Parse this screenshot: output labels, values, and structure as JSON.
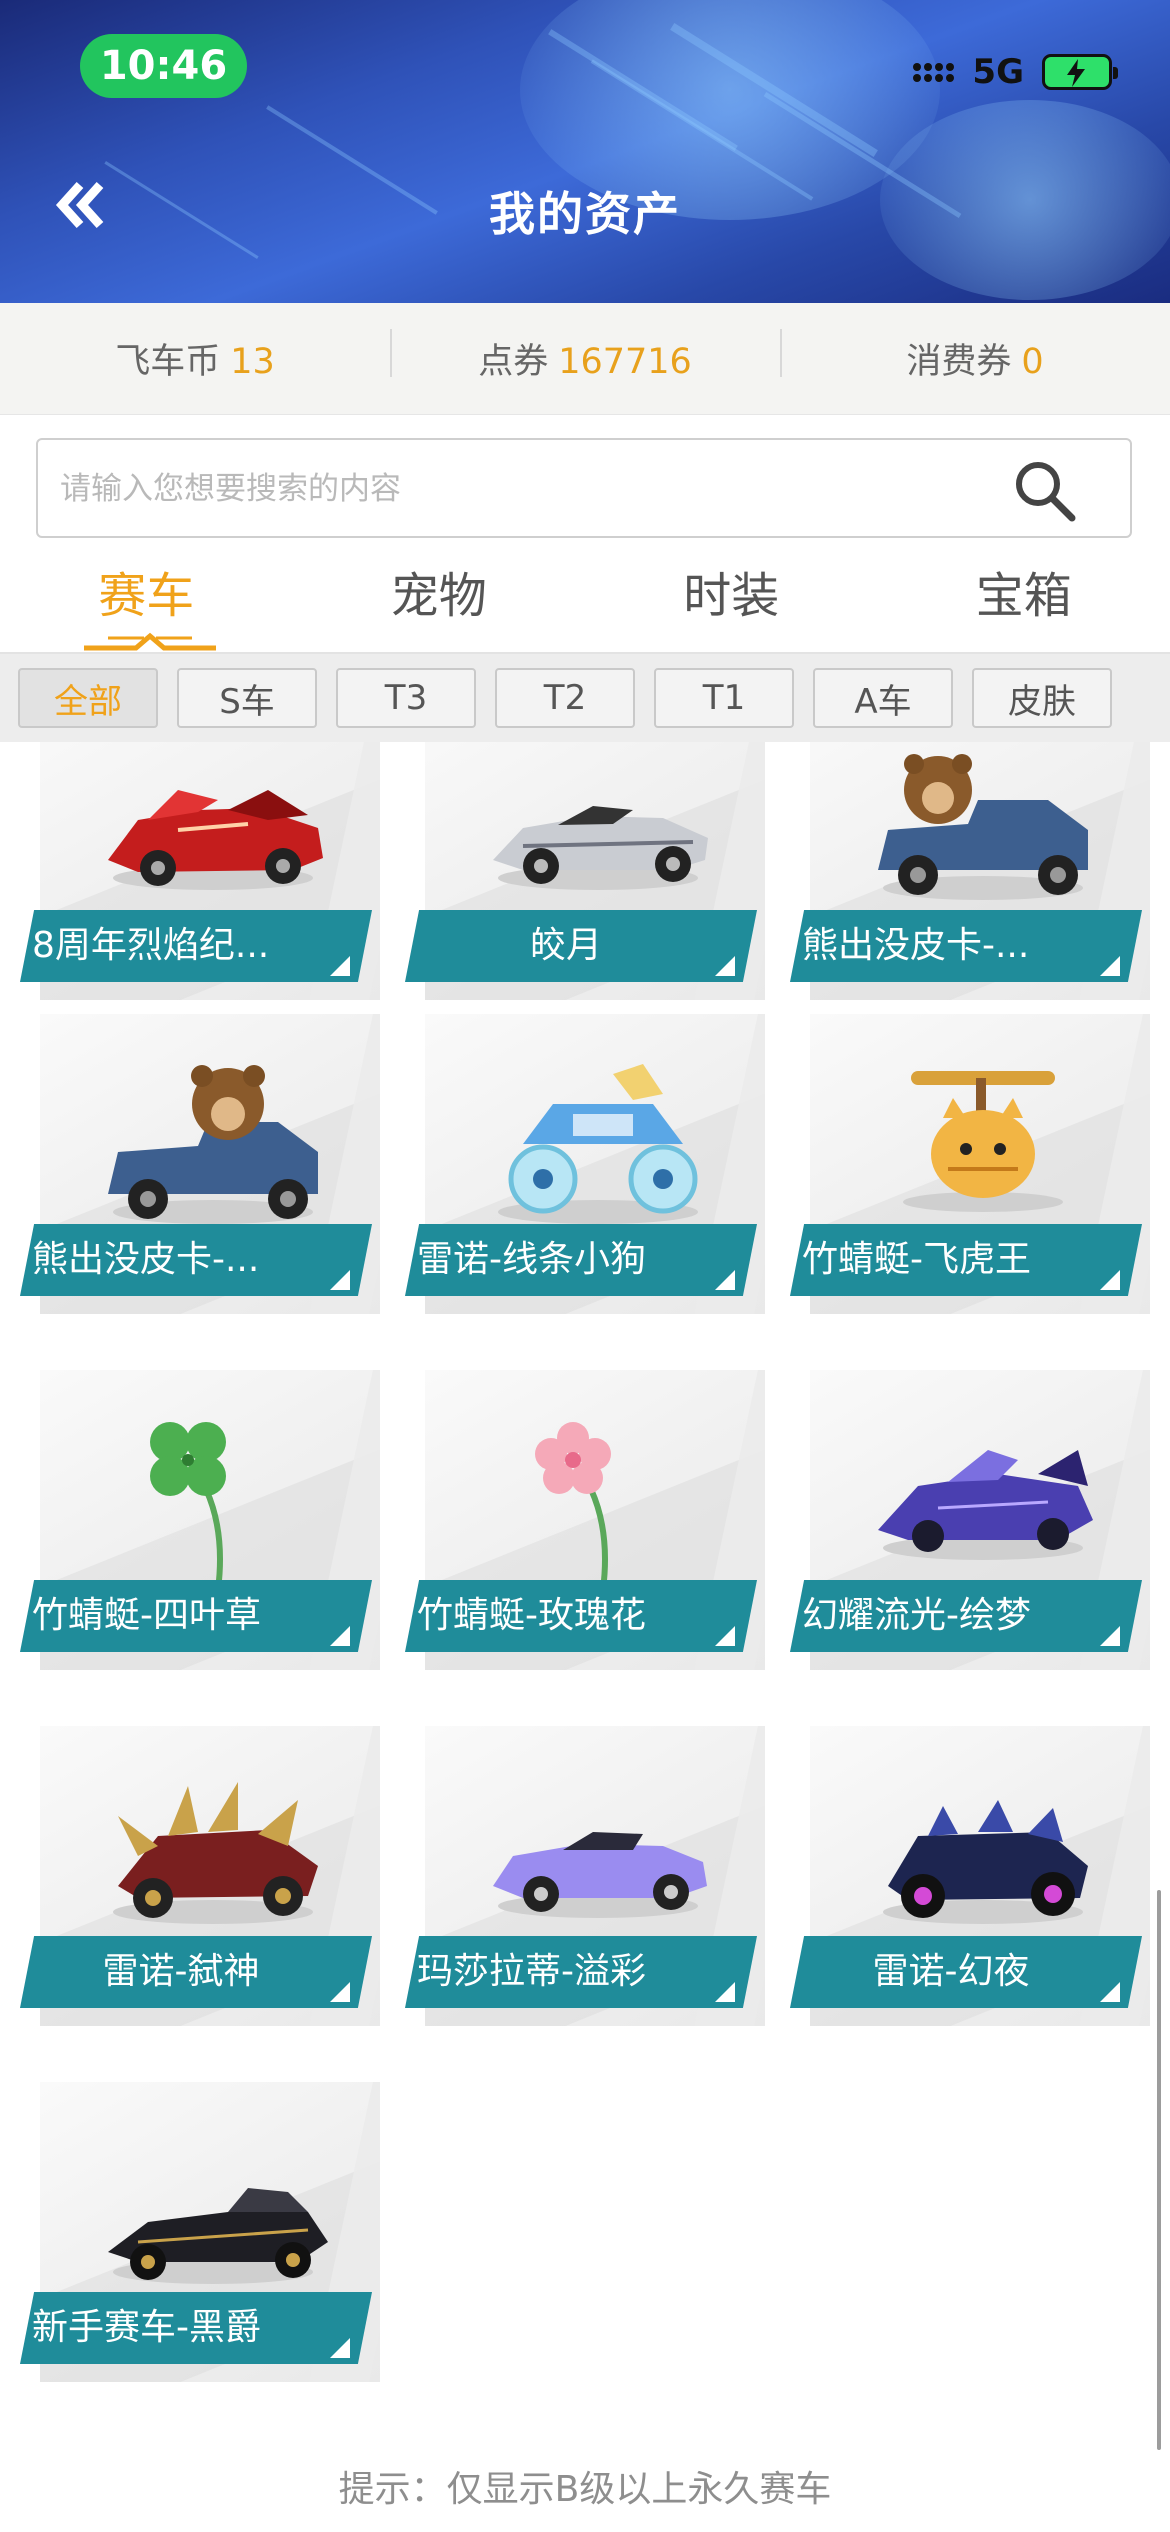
{
  "status_bar": {
    "time": "10:46",
    "network": "5G"
  },
  "header": {
    "title": "我的资产"
  },
  "currencies": [
    {
      "label": "飞车币",
      "value": "13"
    },
    {
      "label": "点券",
      "value": "167716"
    },
    {
      "label": "消费券",
      "value": "0"
    }
  ],
  "search": {
    "placeholder": "请输入您想要搜索的内容"
  },
  "tabs": [
    {
      "label": "赛车",
      "active": true
    },
    {
      "label": "宠物",
      "active": false
    },
    {
      "label": "时装",
      "active": false
    },
    {
      "label": "宝箱",
      "active": false
    }
  ],
  "filters": [
    {
      "label": "全部",
      "active": true
    },
    {
      "label": "S车",
      "active": false
    },
    {
      "label": "T3",
      "active": false
    },
    {
      "label": "T2",
      "active": false
    },
    {
      "label": "T1",
      "active": false
    },
    {
      "label": "A车",
      "active": false
    },
    {
      "label": "皮肤",
      "active": false
    }
  ],
  "items": [
    {
      "name": "8周年烈焰纪...",
      "icon": "red-supercar-icon"
    },
    {
      "name": "皎月",
      "icon": "silver-supercar-icon"
    },
    {
      "name": "熊出没皮卡-...",
      "icon": "bear-pickup-truck-icon"
    },
    {
      "name": "熊出没皮卡-...",
      "icon": "bear-pickup-truck-icon"
    },
    {
      "name": "雷诺-线条小狗",
      "icon": "monster-truck-icon"
    },
    {
      "name": "竹蜻蜓-飞虎王",
      "icon": "tiger-cat-propeller-icon"
    },
    {
      "name": "竹蜻蜓-四叶草",
      "icon": "clover-icon"
    },
    {
      "name": "竹蜻蜓-玫瑰花",
      "icon": "flower-icon"
    },
    {
      "name": "幻耀流光-绘梦",
      "icon": "purple-racecar-icon"
    },
    {
      "name": "雷诺-弑神",
      "icon": "spiked-racecar-icon"
    },
    {
      "name": "玛莎拉蒂-溢彩",
      "icon": "purple-sportscar-icon"
    },
    {
      "name": "雷诺-幻夜",
      "icon": "dark-armored-car-icon"
    },
    {
      "name": "新手赛车-黑爵",
      "icon": "black-kart-icon"
    }
  ],
  "colors": {
    "accent": "#f0a21a",
    "label_bg": "#1f8c9a",
    "status_green": "#22c55e"
  },
  "footer": {
    "hint": "提示：仅显示B级以上永久赛车"
  }
}
